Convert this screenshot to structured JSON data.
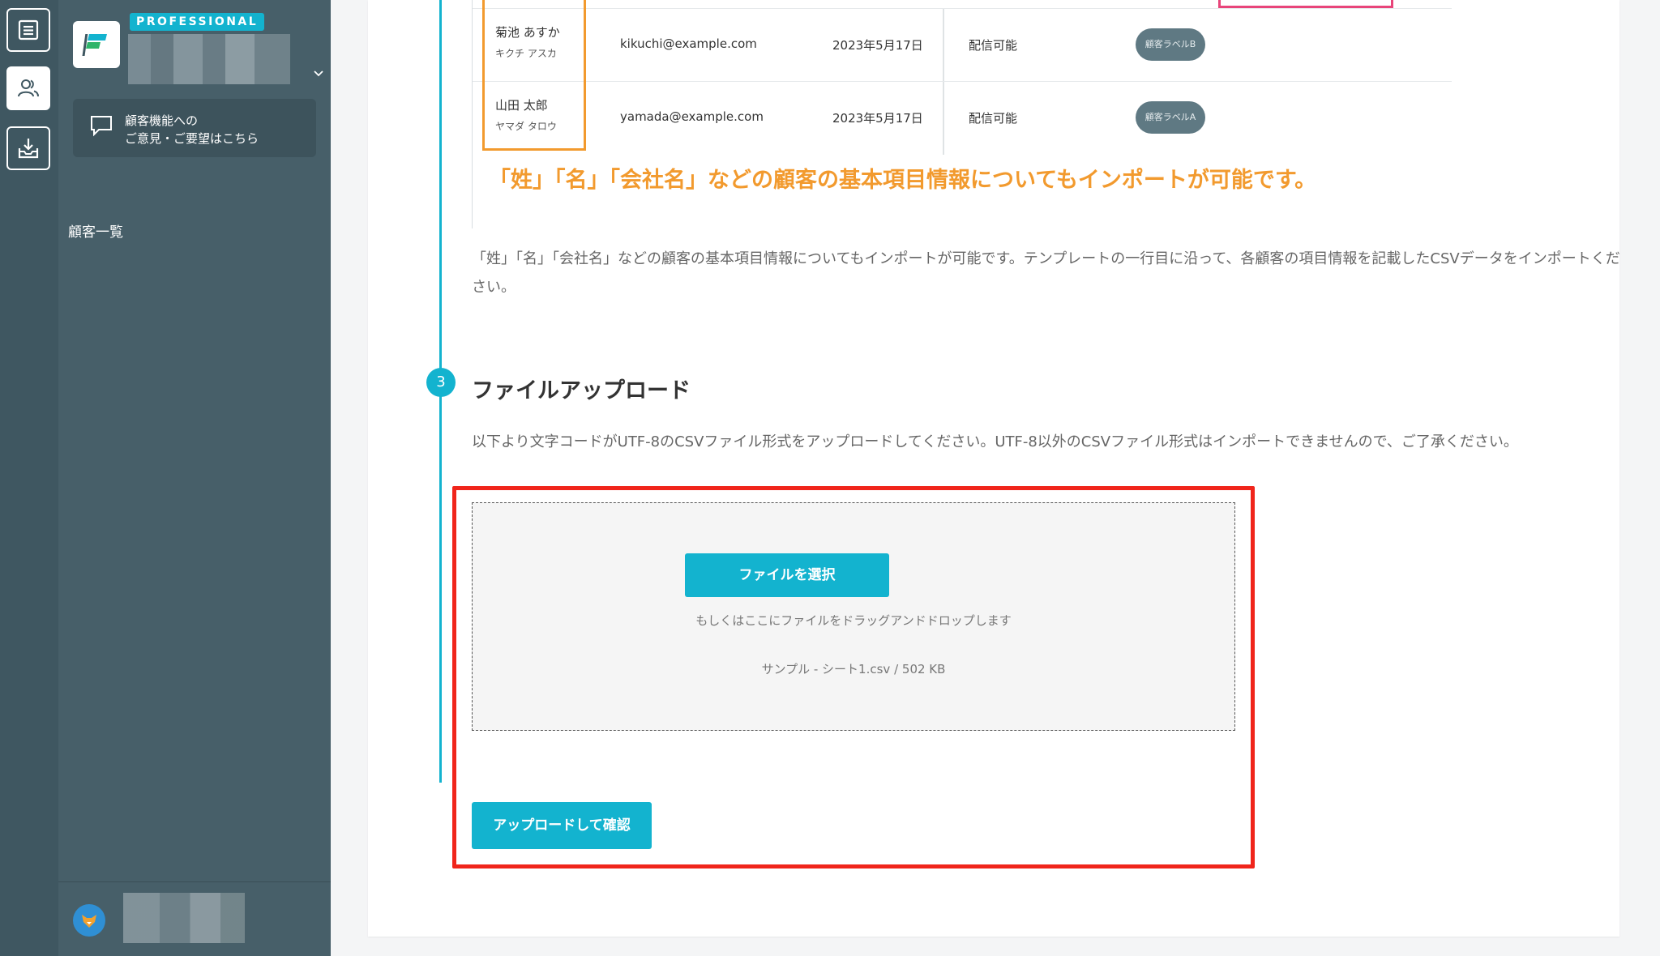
{
  "sidebar": {
    "plan_badge": "PROFESSIONAL",
    "feedback": {
      "line1": "顧客機能への",
      "line2": "ご意見・ご要望はこちら"
    },
    "nav_item": "顧客一覧"
  },
  "example_table": {
    "rows": [
      {
        "name": "菊池 あすか",
        "kana": "キクチ アスカ",
        "email": "kikuchi@example.com",
        "date": "2023年5月17日",
        "status": "配信可能",
        "label": "顧客ラベルB"
      },
      {
        "name": "山田 太郎",
        "kana": "ヤマダ タロウ",
        "email": "yamada@example.com",
        "date": "2023年5月17日",
        "status": "配信可能",
        "label": "顧客ラベルA"
      }
    ],
    "caption": "「姓」「名」「会社名」などの顧客の基本項目情報についてもインポートが可能です。"
  },
  "intro_text": "「姓」「名」「会社名」などの顧客の基本項目情報についてもインポートが可能です。テンプレートの一行目に沿って、各顧客の項目情報を記載したCSVデータをインポートください。",
  "step3": {
    "number": "3",
    "title": "ファイルアップロード",
    "description": "以下より文字コードがUTF-8のCSVファイル形式をアップロードしてください。UTF-8以外のCSVファイル形式はインポートできませんので、ご了承ください。",
    "select_button": "ファイルを選択",
    "drop_hint": "もしくはここにファイルをドラッグアンドドロップします",
    "file_info": "サンプル - シート1.csv / 502 KB",
    "upload_button": "アップロードして確認"
  },
  "colors": {
    "accent": "#13b3cf",
    "sidebar": "#475f69",
    "rail": "#3f5761",
    "annotation_red": "#f0251b",
    "annotation_orange": "#f29a2e",
    "annotation_pink": "#e8457a"
  },
  "icons": {
    "rail": [
      "document-list-icon",
      "users-icon",
      "inbox-download-icon"
    ],
    "feedback": "speech-bubble-icon",
    "workspace_menu": "chevron-down-icon"
  }
}
